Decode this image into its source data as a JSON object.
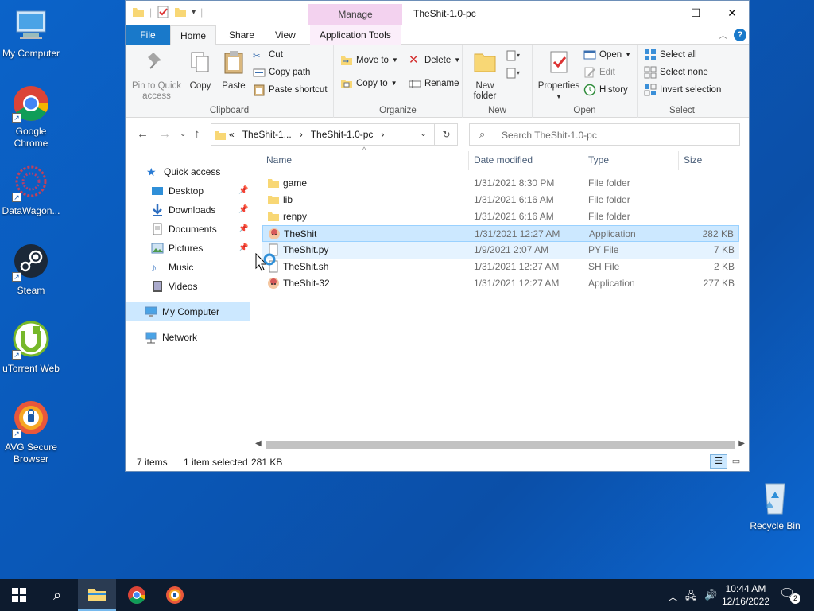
{
  "desktop": {
    "icons": [
      {
        "label": "My Computer"
      },
      {
        "label": "Google Chrome"
      },
      {
        "label": "DataWagon..."
      },
      {
        "label": "Steam"
      },
      {
        "label": "uTorrent Web"
      },
      {
        "label": "AVG Secure Browser"
      },
      {
        "label": "Recycle Bin"
      }
    ]
  },
  "window": {
    "title": "TheShit-1.0-pc",
    "manage_tab": "Manage",
    "controls": {
      "minimize": "—",
      "maximize": "☐",
      "close": "✕"
    }
  },
  "ribbon": {
    "tabs": [
      "File",
      "Home",
      "Share",
      "View",
      "Application Tools"
    ],
    "clipboard": {
      "pin": "Pin to Quick access",
      "copy": "Copy",
      "paste": "Paste",
      "cut": "Cut",
      "copy_path": "Copy path",
      "paste_shortcut": "Paste shortcut",
      "label": "Clipboard"
    },
    "organize": {
      "move_to": "Move to",
      "copy_to": "Copy to",
      "delete": "Delete",
      "rename": "Rename",
      "label": "Organize"
    },
    "new": {
      "new_folder": "New folder",
      "label": "New"
    },
    "open": {
      "properties": "Properties",
      "open": "Open",
      "edit": "Edit",
      "history": "History",
      "label": "Open"
    },
    "select": {
      "select_all": "Select all",
      "select_none": "Select none",
      "invert": "Invert selection",
      "label": "Select"
    }
  },
  "address": {
    "crumbs": [
      "«",
      "TheShit-1...",
      "›",
      "TheShit-1.0-pc",
      "›"
    ],
    "search_placeholder": "Search TheShit-1.0-pc"
  },
  "navpane": {
    "quick_access": "Quick access",
    "items": [
      "Desktop",
      "Downloads",
      "Documents",
      "Pictures",
      "Music",
      "Videos"
    ],
    "my_computer": "My Computer",
    "network": "Network"
  },
  "columns": [
    "Name",
    "Date modified",
    "Type",
    "Size"
  ],
  "files": [
    {
      "name": "game",
      "date": "1/31/2021 8:30 PM",
      "type": "File folder",
      "size": ""
    },
    {
      "name": "lib",
      "date": "1/31/2021 6:16 AM",
      "type": "File folder",
      "size": ""
    },
    {
      "name": "renpy",
      "date": "1/31/2021 6:16 AM",
      "type": "File folder",
      "size": ""
    },
    {
      "name": "TheShit",
      "date": "1/31/2021 12:27 AM",
      "type": "Application",
      "size": "282 KB"
    },
    {
      "name": "TheShit.py",
      "date": "1/9/2021 2:07 AM",
      "type": "PY File",
      "size": "7 KB"
    },
    {
      "name": "TheShit.sh",
      "date": "1/31/2021 12:27 AM",
      "type": "SH File",
      "size": "2 KB"
    },
    {
      "name": "TheShit-32",
      "date": "1/31/2021 12:27 AM",
      "type": "Application",
      "size": "277 KB"
    }
  ],
  "status": {
    "count": "7 items",
    "selected": "1 item selected",
    "size": "281 KB"
  },
  "taskbar": {
    "time": "10:44 AM",
    "date": "12/16/2022",
    "notifications": "2"
  },
  "colors": {
    "accent": "#1979ca",
    "selection": "#cce8ff",
    "folder": "#f8d775",
    "desktop": "#0b63c9"
  }
}
